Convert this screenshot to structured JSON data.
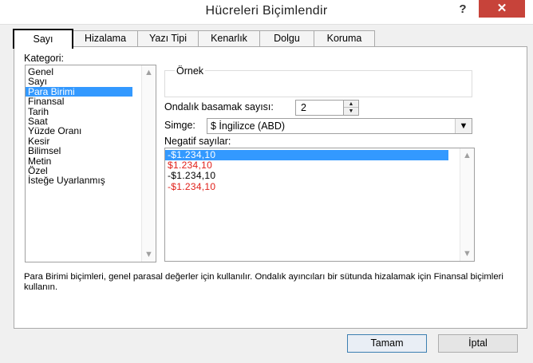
{
  "dialog": {
    "title": "Hücreleri Biçimlendir",
    "help_label": "?",
    "close_label": "✕"
  },
  "tabs": [
    {
      "label": "Sayı",
      "active": true
    },
    {
      "label": "Hizalama",
      "active": false
    },
    {
      "label": "Yazı Tipi",
      "active": false
    },
    {
      "label": "Kenarlık",
      "active": false
    },
    {
      "label": "Dolgu",
      "active": false
    },
    {
      "label": "Koruma",
      "active": false
    }
  ],
  "category": {
    "label": "Kategori:",
    "items": [
      "Genel",
      "Sayı",
      "Para Birimi",
      "Finansal",
      "Tarih",
      "Saat",
      "Yüzde Oranı",
      "Kesir",
      "Bilimsel",
      "Metin",
      "Özel",
      "İsteğe Uyarlanmış"
    ],
    "selected": "Para Birimi"
  },
  "sample": {
    "label": "Örnek",
    "value": ""
  },
  "decimal_places": {
    "label": "Ondalık basamak sayısı:",
    "value": "2"
  },
  "symbol": {
    "label": "Simge:",
    "value": "$ İngilizce (ABD)"
  },
  "negative_numbers": {
    "label": "Negatif sayılar:",
    "items": [
      {
        "text": "-$1.234,10",
        "color": "#000000",
        "selected": true
      },
      {
        "text": "$1.234,10",
        "color": "#e0201a",
        "selected": false
      },
      {
        "text": "-$1.234,10",
        "color": "#000000",
        "selected": false
      },
      {
        "text": "-$1.234,10",
        "color": "#e0201a",
        "selected": false
      }
    ]
  },
  "description": "Para Birimi biçimleri, genel parasal değerler için kullanılır. Ondalık ayıncıları bir sütunda hizalamak için Finansal biçimleri kullanın.",
  "buttons": {
    "ok": "Tamam",
    "cancel": "İptal"
  },
  "colors": {
    "selection": "#3399ff",
    "negative_red": "#e0201a",
    "close_button": "#c7433a"
  },
  "icons": {
    "scroll_up": "▲",
    "scroll_down": "▼",
    "spin_up": "▲",
    "spin_down": "▼",
    "dropdown": "▼"
  }
}
